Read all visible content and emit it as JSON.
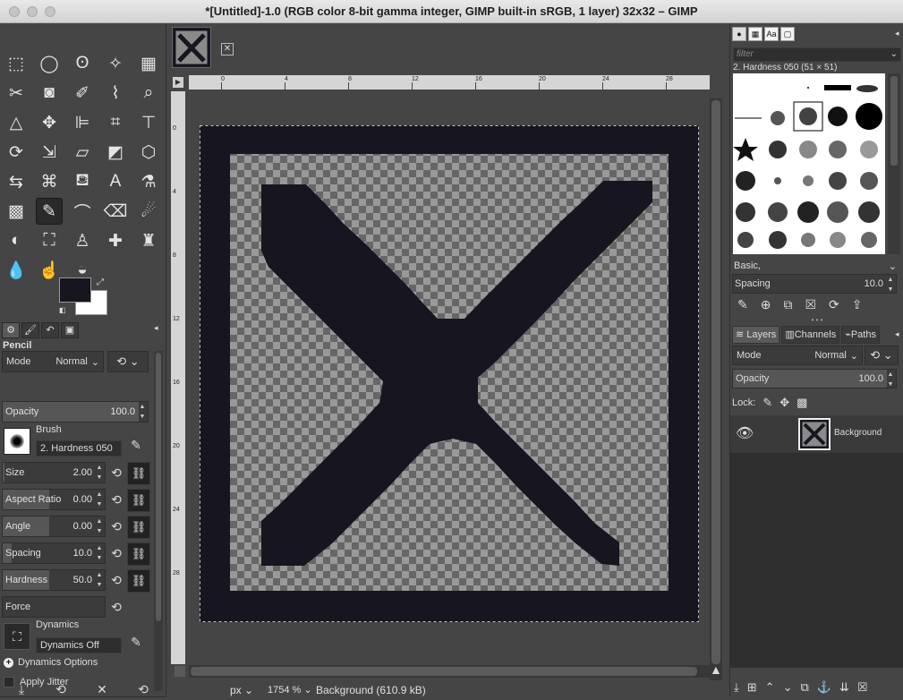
{
  "window": {
    "title": "*[Untitled]-1.0 (RGB color 8-bit gamma integer, GIMP built-in sRGB, 1 layer) 32x32 – GIMP"
  },
  "toolbox": {
    "tools": [
      {
        "name": "rect-select-icon",
        "glyph": "⬚"
      },
      {
        "name": "ellipse-select-icon",
        "glyph": "◯"
      },
      {
        "name": "free-select-icon",
        "glyph": "ʘ"
      },
      {
        "name": "fuzzy-select-icon",
        "glyph": "✧"
      },
      {
        "name": "select-by-color-icon",
        "glyph": "▦"
      },
      {
        "name": "scissors-select-icon",
        "glyph": "✂"
      },
      {
        "name": "foreground-select-icon",
        "glyph": "◙"
      },
      {
        "name": "paths-tool-icon",
        "glyph": "✐"
      },
      {
        "name": "color-picker-icon",
        "glyph": "⌇"
      },
      {
        "name": "zoom-tool-icon",
        "glyph": "⌕"
      },
      {
        "name": "measure-tool-icon",
        "glyph": "△"
      },
      {
        "name": "move-tool-icon",
        "glyph": "✥"
      },
      {
        "name": "align-tool-icon",
        "glyph": "⊫"
      },
      {
        "name": "crop-tool-icon",
        "glyph": "⌗"
      },
      {
        "name": "unified-transform-icon",
        "glyph": "⊤"
      },
      {
        "name": "rotate-tool-icon",
        "glyph": "⟳"
      },
      {
        "name": "scale-tool-icon",
        "glyph": "⇲"
      },
      {
        "name": "shear-tool-icon",
        "glyph": "▱"
      },
      {
        "name": "perspective-tool-icon",
        "glyph": "◩"
      },
      {
        "name": "3d-transform-icon",
        "glyph": "⬡"
      },
      {
        "name": "warp-transform-icon",
        "glyph": "⇆"
      },
      {
        "name": "cage-transform-icon",
        "glyph": "⌘"
      },
      {
        "name": "bucket-fill-icon",
        "glyph": "⛾"
      },
      {
        "name": "text-tool-icon",
        "glyph": "A"
      },
      {
        "name": "gegl-operation-icon",
        "glyph": "⚗"
      },
      {
        "name": "gradient-tool-icon",
        "glyph": "▩"
      },
      {
        "name": "pencil-tool-icon",
        "glyph": "✎"
      },
      {
        "name": "paintbrush-tool-icon",
        "glyph": "⌒"
      },
      {
        "name": "eraser-tool-icon",
        "glyph": "⌫"
      },
      {
        "name": "airbrush-tool-icon",
        "glyph": "☄"
      },
      {
        "name": "ink-tool-icon",
        "glyph": "◐"
      },
      {
        "name": "mypaint-brush-icon",
        "glyph": "⛶"
      },
      {
        "name": "clone-tool-icon",
        "glyph": "♙"
      },
      {
        "name": "heal-tool-icon",
        "glyph": "✚"
      },
      {
        "name": "perspective-clone-icon",
        "glyph": "♜"
      },
      {
        "name": "blur-sharpen-icon",
        "glyph": "💧"
      },
      {
        "name": "smudge-tool-icon",
        "glyph": "☝"
      },
      {
        "name": "dodge-burn-icon",
        "glyph": "◒"
      }
    ],
    "fg_color": "#17151f",
    "bg_color": "#ffffff",
    "tabs": [
      "⚙",
      "🖌",
      "↶",
      "▣"
    ],
    "options": {
      "title": "Pencil",
      "mode_label": "Mode",
      "mode_value": "Normal",
      "opacity_label": "Opacity",
      "opacity_value": "100.0",
      "brush_label": "Brush",
      "brush_value": "2. Hardness 050",
      "size_label": "Size",
      "size_value": "2.00",
      "aspect_label": "Aspect Ratio",
      "aspect_value": "0.00",
      "angle_label": "Angle",
      "angle_value": "0.00",
      "spacing_label": "Spacing",
      "spacing_value": "10.0",
      "hardness_label": "Hardness",
      "hardness_value": "50.0",
      "force_label": "Force",
      "dynamics_label": "Dynamics",
      "dynamics_value": "Dynamics Off",
      "dynamics_options_label": "Dynamics Options",
      "apply_jitter_label": "Apply Jitter"
    },
    "bottom_icons": [
      "⤓",
      "⟲",
      "✕",
      "⟲"
    ]
  },
  "canvas": {
    "ruler_ticks": [
      "0",
      "4",
      "8",
      "12",
      "16",
      "20",
      "24",
      "28",
      "32"
    ],
    "ruler_v_ticks": [
      "0",
      "4",
      "8",
      "12",
      "16",
      "20",
      "24",
      "28"
    ],
    "unit": "px",
    "zoom": "1754 %",
    "status": "Background (610.9 kB)"
  },
  "dock": {
    "brush_filter_placeholder": "filter",
    "brush_selected_label": "2. Hardness 050 (51 × 51)",
    "brush_preset": "Basic,",
    "spacing_label": "Spacing",
    "spacing_value": "10.0",
    "tabs": {
      "layers": "Layers",
      "channels": "Channels",
      "paths": "Paths"
    },
    "layer_mode_label": "Mode",
    "layer_mode_value": "Normal",
    "layer_opacity_label": "Opacity",
    "layer_opacity_value": "100.0",
    "lock_label": "Lock:",
    "layer_name": "Background"
  }
}
